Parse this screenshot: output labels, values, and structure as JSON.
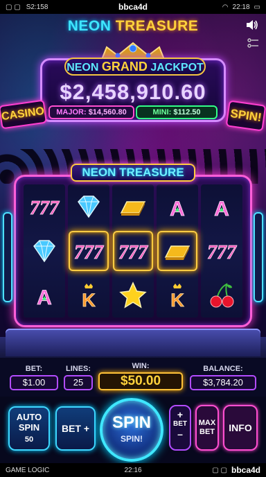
{
  "status_bar": {
    "left_time": "S2:158",
    "center_brand": "bbca4d",
    "right_time": "22:18"
  },
  "game": {
    "title_part1": "NEON",
    "title_part2": "TREASURE",
    "machine_title": "NEON TREASURE"
  },
  "jackpot": {
    "label_part1": "NEON",
    "label_part2": "GRAND",
    "label_part3": "JACKPOT",
    "amount": "$2,458,910.60",
    "major_label": "MAJOR:",
    "major_value": "$14,560.80",
    "mini_label": "MINI:",
    "mini_value": "$112.50"
  },
  "signs": {
    "left": "CASINO",
    "right": "SPIN!"
  },
  "reels": [
    [
      "seven",
      "diamond",
      "a-letter"
    ],
    [
      "diamond",
      "seven",
      "k-letter"
    ],
    [
      "gold-bar",
      "seven",
      "star"
    ],
    [
      "a-letter",
      "gold-bar",
      "k-letter"
    ],
    [
      "a-letter",
      "seven",
      "cherry"
    ]
  ],
  "winning_cells": [
    [
      1,
      1
    ],
    [
      2,
      1
    ],
    [
      3,
      1
    ]
  ],
  "stats": {
    "bet_label": "BET:",
    "bet_value": "$1.00",
    "lines_label": "LINES:",
    "lines_value": "25",
    "win_label": "WIN:",
    "win_value": "$50.00",
    "balance_label": "BALANCE:",
    "balance_value": "$3,784.20"
  },
  "controls": {
    "auto_spin_line1": "AUTO",
    "auto_spin_line2": "SPIN",
    "auto_spin_count": "50",
    "bet_plus": "BET +",
    "spin_main": "SPIN",
    "spin_sub": "SPIN!",
    "bet_plus_sign": "+",
    "bet_small": "BET",
    "bet_minus_sign": "–",
    "max_bet_line1": "MAX",
    "max_bet_line2": "BET",
    "info": "INFO"
  },
  "bottom_bar": {
    "left": "GAME LOGIC",
    "center": "22:16",
    "right_brand": "bbca4d"
  },
  "colors": {
    "neon_cyan": "#3fe6ff",
    "neon_pink": "#ff4fd0",
    "gold": "#ffd23c",
    "purple": "#b34cff"
  }
}
